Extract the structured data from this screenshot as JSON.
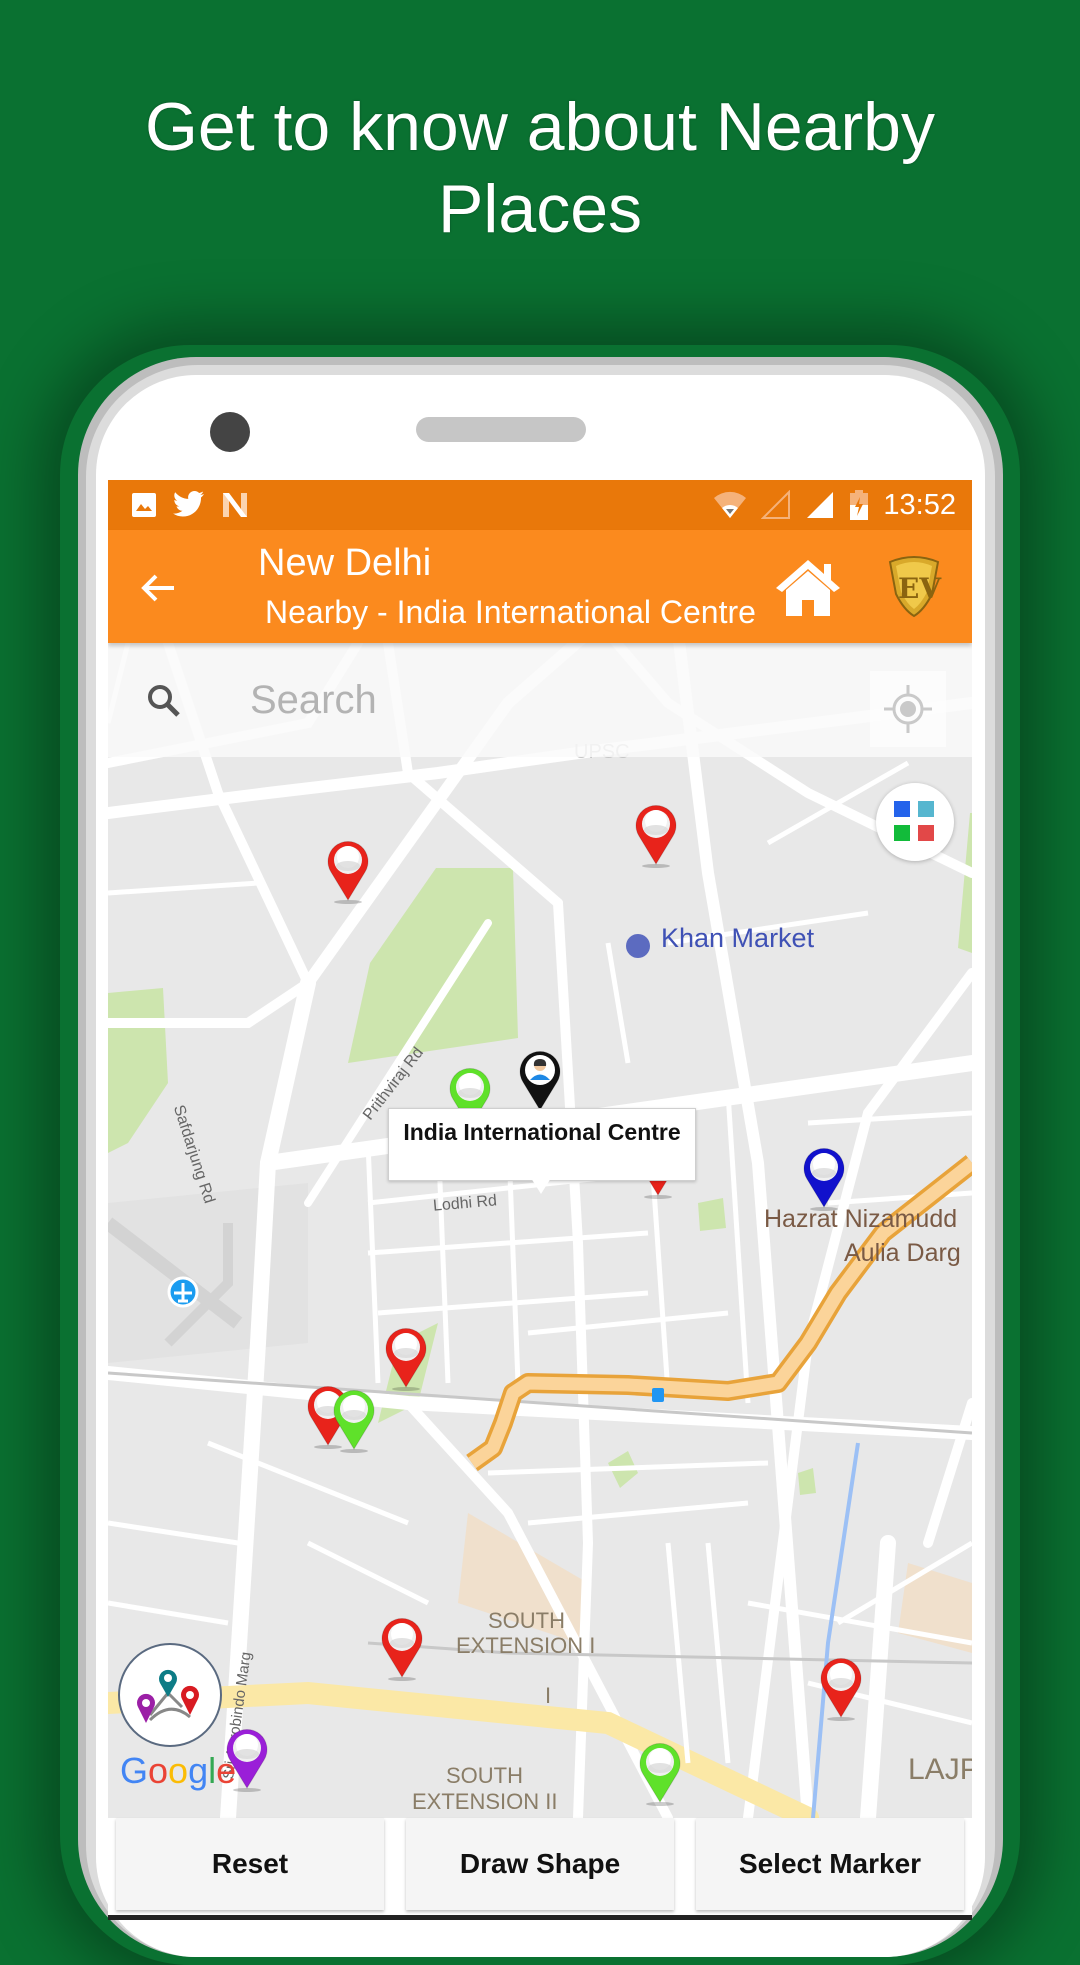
{
  "promo": {
    "headline_line1": "Get to know about Nearby",
    "headline_line2": "Places",
    "background_color": "#0a7131"
  },
  "status_bar": {
    "notification_icons": [
      "image-icon",
      "twitter-icon",
      "n-app-icon"
    ],
    "system_icons": [
      "wifi-icon",
      "signal-empty-icon",
      "signal-full-icon",
      "battery-charging-icon"
    ],
    "time": "13:52",
    "color": "#e9780a"
  },
  "app_bar": {
    "title": "New Delhi",
    "subtitle": "Nearby - India International Centre",
    "color": "#fb8a1e",
    "back_icon": "arrow-left-icon",
    "home_icon": "home-icon",
    "logo": "ev-shield-logo"
  },
  "search": {
    "placeholder": "Search",
    "value": ""
  },
  "map": {
    "labels": {
      "upsc": "UPSC",
      "khan_market": "Khan Market",
      "safdarjung": "Safdarjung Rd",
      "prithviraj": "Prithviraj Rd",
      "lodhi": "Lodhi Rd",
      "nizamuddin_1": "Hazrat Nizamudd",
      "nizamuddin_2": "Aulia Darg",
      "south_ext_1a": "SOUTH",
      "south_ext_1b": "EXTENSION I",
      "south_ext_1c": "I",
      "sri_aurobindo": "Sri Aurobindo Marg",
      "south_ext_2a": "SOUTH",
      "south_ext_2b": "EXTENSION II",
      "lajpat": "LAJP"
    },
    "selected_place": "India International Centre",
    "attribution": "Google",
    "markers": [
      {
        "color": "red",
        "place": "marker-1"
      },
      {
        "color": "red",
        "place": "marker-2"
      },
      {
        "color": "black",
        "place": "India International Centre"
      },
      {
        "color": "green",
        "place": "marker-4"
      },
      {
        "color": "red",
        "place": "marker-5"
      },
      {
        "color": "blue",
        "place": "marker-6"
      },
      {
        "color": "red",
        "place": "marker-7"
      },
      {
        "color": "red",
        "place": "marker-8"
      },
      {
        "color": "green",
        "place": "marker-9"
      },
      {
        "color": "red",
        "place": "marker-10"
      },
      {
        "color": "red",
        "place": "marker-11"
      },
      {
        "color": "purple",
        "place": "marker-12"
      },
      {
        "color": "green",
        "place": "marker-13"
      }
    ],
    "marker_colors": {
      "red": "#e8231b",
      "green": "#5fe12a",
      "blue": "#1111cc",
      "purple": "#9a1fd8",
      "black": "#111111"
    }
  },
  "buttons": {
    "reset": "Reset",
    "draw_shape": "Draw Shape",
    "select_marker": "Select Marker"
  }
}
